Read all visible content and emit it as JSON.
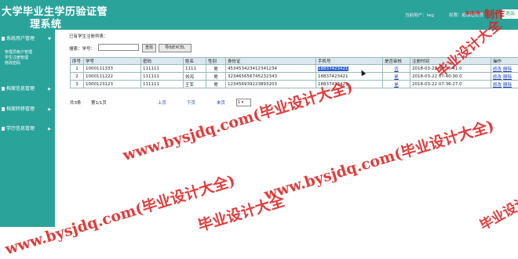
{
  "header": {
    "title_line1": "大学毕业生学历验证管",
    "title_line2": "理系统",
    "current_user": "当前用户：lwg",
    "role": "权限：超级管理员",
    "logout_label": "退出",
    "made_mark": "*** 制作"
  },
  "sidebar": {
    "menus": [
      {
        "label": "系统用户管理",
        "arrow": "▼"
      },
      {
        "label": "档案信息管理",
        "arrow": "▶"
      },
      {
        "label": "档案转移管理",
        "arrow": "▶"
      },
      {
        "label": "学历信息管理",
        "arrow": "▶"
      }
    ],
    "submenu": [
      "管理员帐户管理",
      "学生注册管理",
      "修改密码"
    ]
  },
  "main": {
    "registered_label": "已有学生注册列表：",
    "search_label": "搜索：学号：",
    "search_value": "",
    "search_button": "查找",
    "export_button": "导出EXCEL",
    "columns": [
      "序号",
      "学号",
      "密码",
      "姓名",
      "性别",
      "身份证",
      "手机号",
      "是否审核",
      "注册时间",
      "操作"
    ],
    "rows": [
      {
        "no": "1",
        "student_id": "1000111333",
        "password": "111111",
        "name": "1111",
        "gender": "男",
        "id_card": "453453423412341234",
        "phone": "18837423421",
        "approved": "否",
        "reg_time": "2018-03-22 08:36:41.0",
        "op_edit": "修改",
        "op_delete": "删除"
      },
      {
        "no": "2",
        "student_id": "1000111222",
        "password": "111111",
        "name": "刘鸿",
        "gender": "男",
        "id_card": "323465656745232343",
        "phone": "18837423421",
        "approved": "是",
        "reg_time": "2018-03-22 07:40:30.0",
        "op_edit": "修改",
        "op_delete": "删除"
      },
      {
        "no": "3",
        "student_id": "1000123123",
        "password": "111111",
        "name": "王军",
        "gender": "男",
        "id_card": "123456939223893203",
        "phone": "18837423421",
        "approved": "是",
        "reg_time": "2018-03-22 07:36:27.0",
        "op_edit": "修改",
        "op_delete": "删除"
      }
    ],
    "pager": {
      "total": "共3条",
      "page_info": "第1/1页",
      "prev": "上页",
      "next": "下页",
      "last": "末页",
      "page_select": "1"
    }
  },
  "watermark": {
    "text_a": "www.bysjdq.com(毕业设计大全)",
    "text_b": "毕业设计大全",
    "color": "#e02020"
  },
  "colors": {
    "theme": "#2aa39b",
    "header_cell": "#dbe7ef",
    "link": "#1a3fbf"
  }
}
